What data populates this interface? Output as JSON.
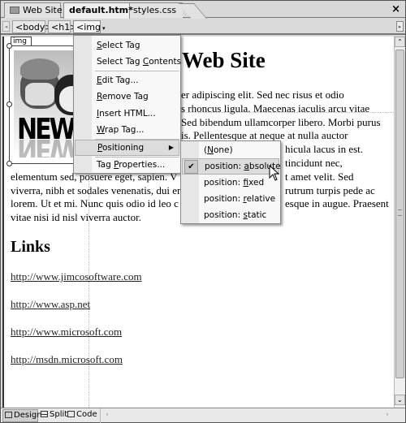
{
  "tabs": [
    {
      "label": "Web Site",
      "icon": "website-icon",
      "active": false
    },
    {
      "label": "default.htm*",
      "active": true
    },
    {
      "label": "styles.css",
      "active": false
    }
  ],
  "tab_close_label": "×",
  "tag_navigator": {
    "crumbs": [
      "<body>",
      "<h1>",
      "<img"
    ],
    "dropdown_glyph": "▾",
    "scroll_left_glyph": "◂",
    "scroll_right_glyph": "▸"
  },
  "editor": {
    "image_tag_label": "img",
    "image_logo_text": "NEWim",
    "heading": "Web Site",
    "paragraph_lines": [
      {
        "left": "",
        "right": "er adipiscing elit. Sed nec risus et odio"
      },
      {
        "left": "",
        "right": "s rhoncus ligula. Maecenas iaculis arcu vitae"
      },
      {
        "left": "",
        "right": "Sed bibendum ullamcorper libero. Morbi purus"
      },
      {
        "left": "",
        "right": "is. Pellentesque at neque at nulla auctor"
      },
      {
        "left": "",
        "right": "hicula lacus in est."
      },
      {
        "left": "",
        "right": "tincidunt nec,"
      },
      {
        "left": "elementum sed, posuere eget, sapien. V",
        "right": "t amet velit. Sed"
      },
      {
        "left": "viverra, nibh et sodales venenatis, dui er",
        "right": "rutrum turpis pede ac"
      },
      {
        "left": "lorem. Ut et mi. Nunc quis odio id leo c",
        "right": "esque in augue. Praesent"
      },
      {
        "left": "vitae nisi id nisl viverra auctor.",
        "right": ""
      }
    ],
    "links_heading": "Links",
    "links": [
      "http://www.jimcosoftware.com",
      "http://www.asp.net",
      "http://www.microsoft.com",
      "http://msdn.microsoft.com"
    ]
  },
  "context_menu": {
    "items": [
      {
        "pre": "",
        "u": "S",
        "post": "elect Tag"
      },
      {
        "pre": "Select Tag ",
        "u": "C",
        "post": "ontents"
      },
      {
        "pre": "",
        "u": "E",
        "post": "dit Tag..."
      },
      {
        "pre": "",
        "u": "R",
        "post": "emove Tag"
      },
      {
        "pre": "",
        "u": "I",
        "post": "nsert HTML..."
      },
      {
        "pre": "",
        "u": "W",
        "post": "rap Tag..."
      },
      {
        "pre": "",
        "u": "P",
        "post": "ositioning",
        "submenu": true,
        "highlighted": true
      },
      {
        "pre": "Tag ",
        "u": "P",
        "post": "roperties..."
      }
    ],
    "submenu_arrow": "▶"
  },
  "positioning_submenu": {
    "items": [
      {
        "pre": "(",
        "u": "N",
        "post": "one)",
        "checked": false
      },
      {
        "pre": "position: ",
        "u": "a",
        "post": "bsolute",
        "checked": true
      },
      {
        "pre": "position: ",
        "u": "f",
        "post": "ixed",
        "checked": false
      },
      {
        "pre": "position: ",
        "u": "r",
        "post": "elative",
        "checked": false
      },
      {
        "pre": "position: ",
        "u": "s",
        "post": "tatic",
        "checked": false
      }
    ],
    "check_glyph": "✔"
  },
  "view_tabs": [
    {
      "label": "Design",
      "active": true
    },
    {
      "label": "Split",
      "active": false
    },
    {
      "label": "Code",
      "active": false
    }
  ],
  "scrollbar": {
    "up": "⌃",
    "down": "⌄",
    "left": "‹",
    "right": "›"
  }
}
